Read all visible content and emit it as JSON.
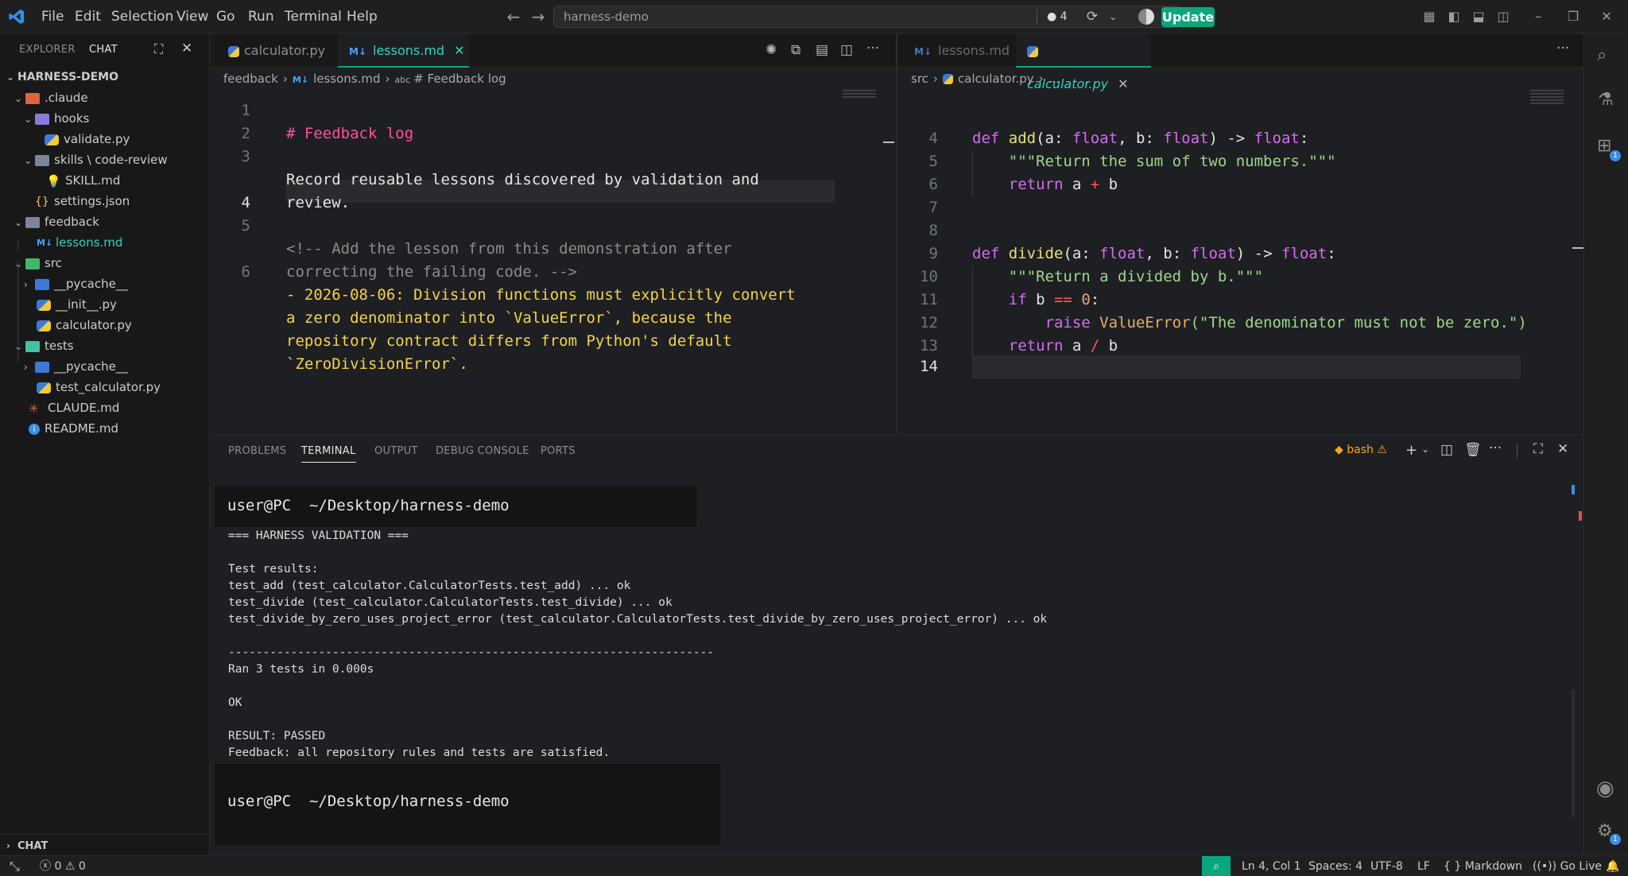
{
  "menu": [
    "File",
    "Edit",
    "Selection",
    "View",
    "Go",
    "Run",
    "Terminal",
    "Help"
  ],
  "command_center": {
    "text": "harness-demo",
    "badge": "4"
  },
  "update_button": "Update",
  "sidebar": {
    "tabs": [
      "EXPLORER",
      "CHAT"
    ],
    "root": "HARNESS-DEMO",
    "items": [
      {
        "label": ".claude"
      },
      {
        "label": "hooks"
      },
      {
        "label": "validate.py"
      },
      {
        "label": "skills \\ code-review"
      },
      {
        "label": "SKILL.md"
      },
      {
        "label": "settings.json"
      },
      {
        "label": "feedback"
      },
      {
        "label": "lessons.md"
      },
      {
        "label": "src"
      },
      {
        "label": "__pycache__"
      },
      {
        "label": "__init__.py"
      },
      {
        "label": "calculator.py"
      },
      {
        "label": "tests"
      },
      {
        "label": "__pycache__"
      },
      {
        "label": "test_calculator.py"
      },
      {
        "label": "CLAUDE.md"
      },
      {
        "label": "README.md"
      }
    ],
    "chat_footer": "CHAT"
  },
  "left_editor": {
    "tabs": [
      {
        "label": "calculator.py"
      },
      {
        "label": "lessons.md"
      }
    ],
    "breadcrumb": [
      "feedback",
      "lessons.md",
      "# Feedback log"
    ],
    "line_numbers": [
      "1",
      "2",
      "3",
      "",
      "4",
      "5",
      "",
      "6",
      "",
      "",
      ""
    ],
    "lines": [
      "# Feedback log",
      "",
      "Record reusable lessons discovered by validation and",
      "review.",
      "",
      "<!-- Add the lesson from this demonstration after",
      "correcting the failing code. -->",
      "- 2026-08-06: Division functions must explicitly convert",
      "a zero denominator into `ValueError`, because the",
      "repository contract differs from Python's default",
      "`ZeroDivisionError`."
    ]
  },
  "right_editor": {
    "tabs": [
      {
        "label": "lessons.md"
      },
      {
        "label": "calculator.py"
      }
    ],
    "breadcrumb": [
      "src",
      "calculator.py",
      "..."
    ],
    "line_numbers": [
      "4",
      "5",
      "6",
      "7",
      "8",
      "9",
      "10",
      "11",
      "12",
      "13",
      "14"
    ],
    "code": {
      "l4": {
        "a": "def ",
        "b": "add",
        "c": "(a: ",
        "d": "float",
        ",": ", b: ",
        "e": "float",
        "f": ") -> ",
        "g": "float",
        ":": ":"
      },
      "l5": "    \"\"\"Return the sum of two numbers.\"\"\"",
      "l6": {
        "a": "    return ",
        "b": "a ",
        "c": "+",
        "d": " b"
      },
      "l9": {
        "a": "def ",
        "b": "divide",
        "c": "(a: ",
        "d": "float",
        ",": ", b: ",
        "e": "float",
        "f": ") -> ",
        "g": "float",
        ":": ":"
      },
      "l10": "    \"\"\"Return a divided by b.\"\"\"",
      "l11": {
        "a": "    if ",
        "b": "b ",
        "c": "==",
        "d": " ",
        "e": "0",
        ":": ":"
      },
      "l12": {
        "a": "        raise ",
        "b": "ValueError",
        "c": "(\"The denominator must not be zero.\")"
      },
      "l13": {
        "a": "    return ",
        "b": "a ",
        "c": "/",
        "d": " b"
      }
    }
  },
  "panel": {
    "tabs": [
      "PROBLEMS",
      "TERMINAL",
      "OUTPUT",
      "DEBUG CONSOLE",
      "PORTS"
    ],
    "shell": "bash",
    "prompt": "user@PC  ~/Desktop/harness-demo",
    "output": [
      "=== HARNESS VALIDATION ===",
      "",
      "Test results:",
      "test_add (test_calculator.CalculatorTests.test_add) ... ok",
      "test_divide (test_calculator.CalculatorTests.test_divide) ... ok",
      "test_divide_by_zero_uses_project_error (test_calculator.CalculatorTests.test_divide_by_zero_uses_project_error) ... ok",
      "",
      "----------------------------------------------------------------------",
      "Ran 3 tests in 0.000s",
      "",
      "OK",
      "",
      "RESULT: PASSED",
      "Feedback: all repository rules and tests are satisfied."
    ]
  },
  "status": {
    "errors": "0",
    "warnings": "0",
    "position": "Ln 4, Col 1",
    "spaces": "Spaces: 4",
    "encoding": "UTF-8",
    "eol": "LF",
    "language": "Markdown",
    "golive": "Go Live"
  },
  "colors": {
    "accent": "#0aa67e",
    "heading": "#ff4fa3",
    "yellow": "#f5d44a",
    "comment": "#8b8b8b"
  }
}
